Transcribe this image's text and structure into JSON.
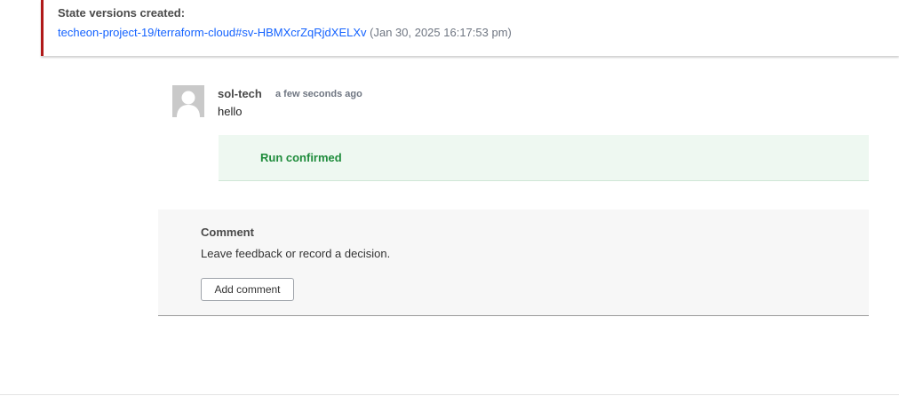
{
  "state_versions": {
    "title": "State versions created:",
    "link_text": "techeon-project-19/terraform-cloud#sv-HBMXcrZqRjdXELXv",
    "timestamp": "(Jan 30, 2025 16:17:53 pm)"
  },
  "comment": {
    "author": "sol-tech",
    "relative_time": "a few seconds ago",
    "text": "hello",
    "avatar_icon": "default-user-icon"
  },
  "status": {
    "label": "Run confirmed",
    "color": "#1f8c3c"
  },
  "comment_form": {
    "heading": "Comment",
    "description": "Leave feedback or record a decision.",
    "button_label": "Add comment"
  },
  "colors": {
    "link": "#1563ff",
    "accent_border": "#b01a1a",
    "confirmed_bg": "#eef8f1"
  }
}
